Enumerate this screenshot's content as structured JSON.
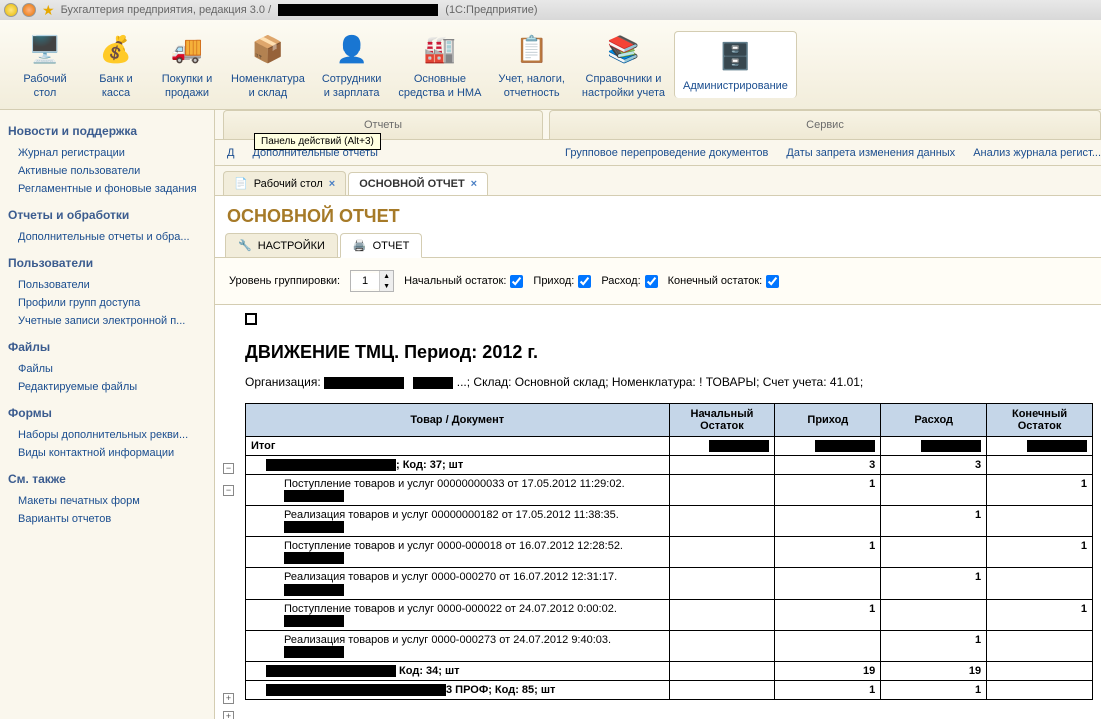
{
  "titlebar": {
    "title_prefix": "Бухгалтерия предприятия, редакция 3.0 /",
    "title_suffix": "(1С:Предприятие)"
  },
  "toolbar": [
    {
      "label": "Рабочий\nстол",
      "icon": "🖥️"
    },
    {
      "label": "Банк и\nкасса",
      "icon": "💰"
    },
    {
      "label": "Покупки и\nпродажи",
      "icon": "🚚"
    },
    {
      "label": "Номенклатура\nи склад",
      "icon": "📦"
    },
    {
      "label": "Сотрудники\nи зарплата",
      "icon": "👤"
    },
    {
      "label": "Основные\nсредства и НМА",
      "icon": "🏭"
    },
    {
      "label": "Учет, налоги,\nотчетность",
      "icon": "📋"
    },
    {
      "label": "Справочники и\nнастройки учета",
      "icon": "📚"
    },
    {
      "label": "Администрирование",
      "icon": "🗄️"
    }
  ],
  "sidebar": {
    "g1": {
      "title": "Новости и поддержка"
    },
    "g2": {
      "links": [
        "Журнал регистрации",
        "Активные пользователи",
        "Регламентные и фоновые задания"
      ]
    },
    "g3": {
      "title": "Отчеты и обработки",
      "links": [
        "Дополнительные отчеты и обра..."
      ]
    },
    "g4": {
      "title": "Пользователи",
      "links": [
        "Пользователи",
        "Профили групп доступа",
        "Учетные записи электронной п..."
      ]
    },
    "g5": {
      "title": "Файлы",
      "links": [
        "Файлы",
        "Редактируемые файлы"
      ]
    },
    "g6": {
      "title": "Формы",
      "links": [
        "Наборы дополнительных рекви...",
        "Виды контактной информации"
      ]
    },
    "g7": {
      "title": "См. также",
      "links": [
        "Макеты печатных форм",
        "Варианты отчетов"
      ]
    }
  },
  "sectabs": {
    "left": "Отчеты",
    "right": "Сервис",
    "tooltip": "Панель действий (Alt+3)",
    "links_left": [
      "Д",
      "Дополнительные отчеты"
    ],
    "links_right": [
      "Групповое перепроведение документов",
      "Даты запрета изменения данных",
      "Анализ журнала регист..."
    ]
  },
  "doctabs": [
    {
      "label": "Рабочий стол",
      "icon": "📄"
    },
    {
      "label": "ОСНОВНОЙ ОТЧЕТ",
      "active": true
    }
  ],
  "report": {
    "title": "ОСНОВНОЙ ОТЧЕТ",
    "subtabs": [
      {
        "label": "НАСТРОЙКИ",
        "icon": "🔧"
      },
      {
        "label": "ОТЧЕТ",
        "icon": "🖨️",
        "active": true
      }
    ],
    "controls": {
      "group_label": "Уровень группировки:",
      "group_value": "1",
      "opts": [
        "Начальный остаток:",
        "Приход:",
        "Расход:",
        "Конечный остаток:"
      ]
    },
    "heading": "ДВИЖЕНИЕ ТМЦ. Период: 2012 г.",
    "desc_prefix": "Организация: ",
    "desc_suffix": "...; Склад: Основной склад; Номенклатура: ! ТОВАРЫ; Счет учета: 41.01;",
    "columns": [
      "Товар / Документ",
      "Начальный Остаток",
      "Приход",
      "Расход",
      "Конечный Остаток"
    ],
    "rows": [
      {
        "type": "total",
        "c0": "Итог",
        "c1": "",
        "c2": "",
        "c3": "",
        "c4": ""
      },
      {
        "type": "group",
        "c0": "; Код: 37; шт",
        "c1": "",
        "c2": "3",
        "c3": "3",
        "c4": ""
      },
      {
        "c0": "Поступление товаров и услуг 00000000033 от 17.05.2012 11:29:02.",
        "c2": "1",
        "c4": "1"
      },
      {
        "c0": "Реализация товаров и услуг 00000000182 от 17.05.2012 11:38:35.",
        "c3": "1"
      },
      {
        "c0": "Поступление товаров и услуг 0000-000018 от 16.07.2012 12:28:52.",
        "c2": "1",
        "c4": "1"
      },
      {
        "c0": "Реализация товаров и услуг 0000-000270 от 16.07.2012 12:31:17.",
        "c3": "1"
      },
      {
        "c0": "Поступление товаров и услуг 0000-000022 от 24.07.2012 0:00:02.",
        "c2": "1",
        "c4": "1"
      },
      {
        "c0": "Реализация товаров и услуг 0000-000273 от 24.07.2012 9:40:03.",
        "c3": "1"
      },
      {
        "type": "group",
        "c0_suffix": " Код: 34; шт",
        "c2": "19",
        "c3": "19"
      },
      {
        "type": "group2",
        "c0_suffix": "3 ПРОФ; Код: 85; шт",
        "c2": "1",
        "c3": "1"
      }
    ]
  }
}
